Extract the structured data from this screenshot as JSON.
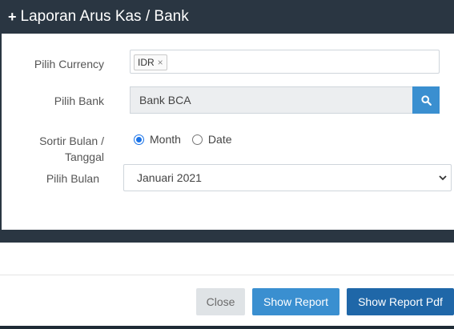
{
  "header": {
    "title": "Laporan Arus Kas / Bank",
    "plus_icon": "+"
  },
  "form": {
    "currency_label": "Pilih Currency",
    "currency_tag": "IDR",
    "currency_tag_close": "×",
    "bank_label": "Pilih Bank",
    "bank_value": "Bank BCA",
    "sort_label_line1": "Sortir Bulan /",
    "sort_label_line2": "Tanggal",
    "radio_month": "Month",
    "radio_date": "Date",
    "month_label": "Pilih Bulan",
    "month_value": "Januari 2021"
  },
  "footer": {
    "close_label": "Close",
    "show_report_label": "Show Report",
    "show_report_pdf_label": "Show Report Pdf"
  },
  "colors": {
    "header_bg": "#2a3642",
    "primary": "#3a8fd0",
    "primary_dark": "#1f67a8",
    "radio_checked": "#1a73e8"
  }
}
